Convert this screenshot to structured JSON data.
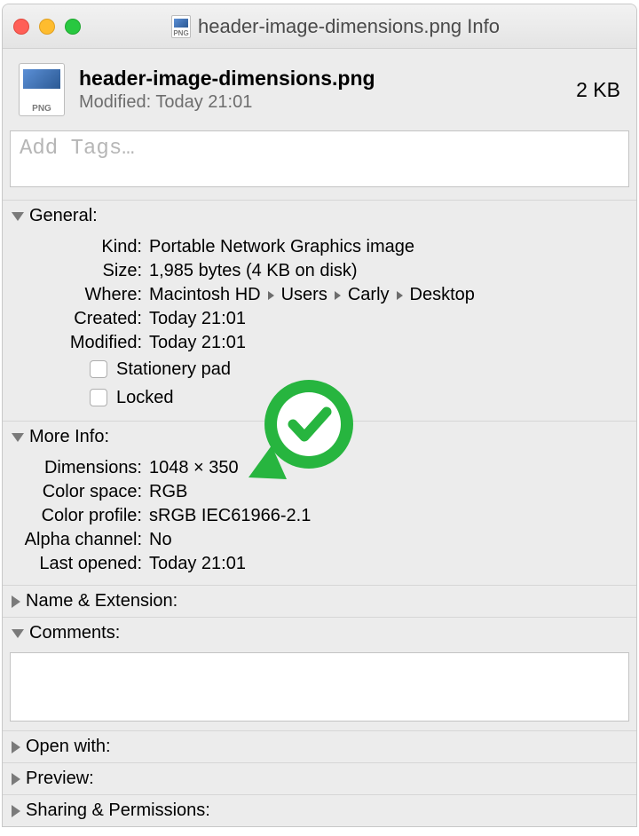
{
  "window": {
    "title": "header-image-dimensions.png Info",
    "icon_badge": "PNG"
  },
  "summary": {
    "filename": "header-image-dimensions.png",
    "modified_label": "Modified:",
    "modified_value": "Today 21:01",
    "size_display": "2 KB",
    "icon_badge": "PNG"
  },
  "tags": {
    "placeholder": "Add Tags…"
  },
  "sections": {
    "general": {
      "title": "General:",
      "kind_label": "Kind:",
      "kind_value": "Portable Network Graphics image",
      "size_label": "Size:",
      "size_value": "1,985 bytes (4 KB on disk)",
      "where_label": "Where:",
      "where_segments": [
        "Macintosh HD",
        "Users",
        "Carly",
        "Desktop"
      ],
      "created_label": "Created:",
      "created_value": "Today 21:01",
      "modified_label": "Modified:",
      "modified_value": "Today 21:01",
      "stationery_label": "Stationery pad",
      "stationery_checked": false,
      "locked_label": "Locked",
      "locked_checked": false
    },
    "more_info": {
      "title": "More Info:",
      "dimensions_label": "Dimensions:",
      "dimensions_value": "1048 × 350",
      "color_space_label": "Color space:",
      "color_space_value": "RGB",
      "color_profile_label": "Color profile:",
      "color_profile_value": "sRGB IEC61966-2.1",
      "alpha_label": "Alpha channel:",
      "alpha_value": "No",
      "last_opened_label": "Last opened:",
      "last_opened_value": "Today 21:01"
    },
    "name_ext": {
      "title": "Name & Extension:"
    },
    "comments": {
      "title": "Comments:",
      "value": ""
    },
    "open_with": {
      "title": "Open with:"
    },
    "preview": {
      "title": "Preview:"
    },
    "sharing": {
      "title": "Sharing & Permissions:"
    }
  },
  "annotation": {
    "color": "#27b53f"
  }
}
